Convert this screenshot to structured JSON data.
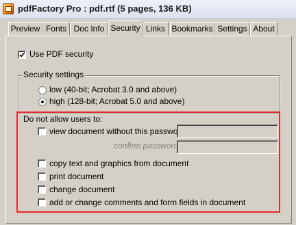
{
  "window": {
    "title": "pdfFactory Pro : pdf.rtf (5 pages, 136 KB)"
  },
  "tabs": [
    {
      "label": "Preview",
      "active": false
    },
    {
      "label": "Fonts",
      "active": false
    },
    {
      "label": "Doc Info",
      "active": false
    },
    {
      "label": "Security",
      "active": true
    },
    {
      "label": "Links",
      "active": false
    },
    {
      "label": "Bookmarks",
      "active": false
    },
    {
      "label": "Settings",
      "active": false
    },
    {
      "label": "About",
      "active": false
    }
  ],
  "security": {
    "use_pdf_security_label": "Use PDF security",
    "use_pdf_security_checked": true,
    "settings_group_label": "Security settings",
    "low_label": "low  (40-bit; Acrobat 3.0 and above)",
    "high_label": "high  (128-bit; Acrobat 5.0 and above)",
    "selected_level": "high"
  },
  "restrictions": {
    "heading": "Do not allow users to:",
    "view_password_label": "view document without this password:",
    "view_password_value": "",
    "confirm_password_label": "confirm password:",
    "confirm_password_value": "",
    "copy_label": "copy text and graphics from document",
    "print_label": "print document",
    "change_label": "change document",
    "comments_label": "add or change comments and form fields in document",
    "checked": {
      "view": false,
      "copy": false,
      "print": false,
      "change": false,
      "comments": false
    }
  },
  "colors": {
    "highlight_border": "#e42c2c",
    "dialog_background": "#d4d0c8"
  }
}
